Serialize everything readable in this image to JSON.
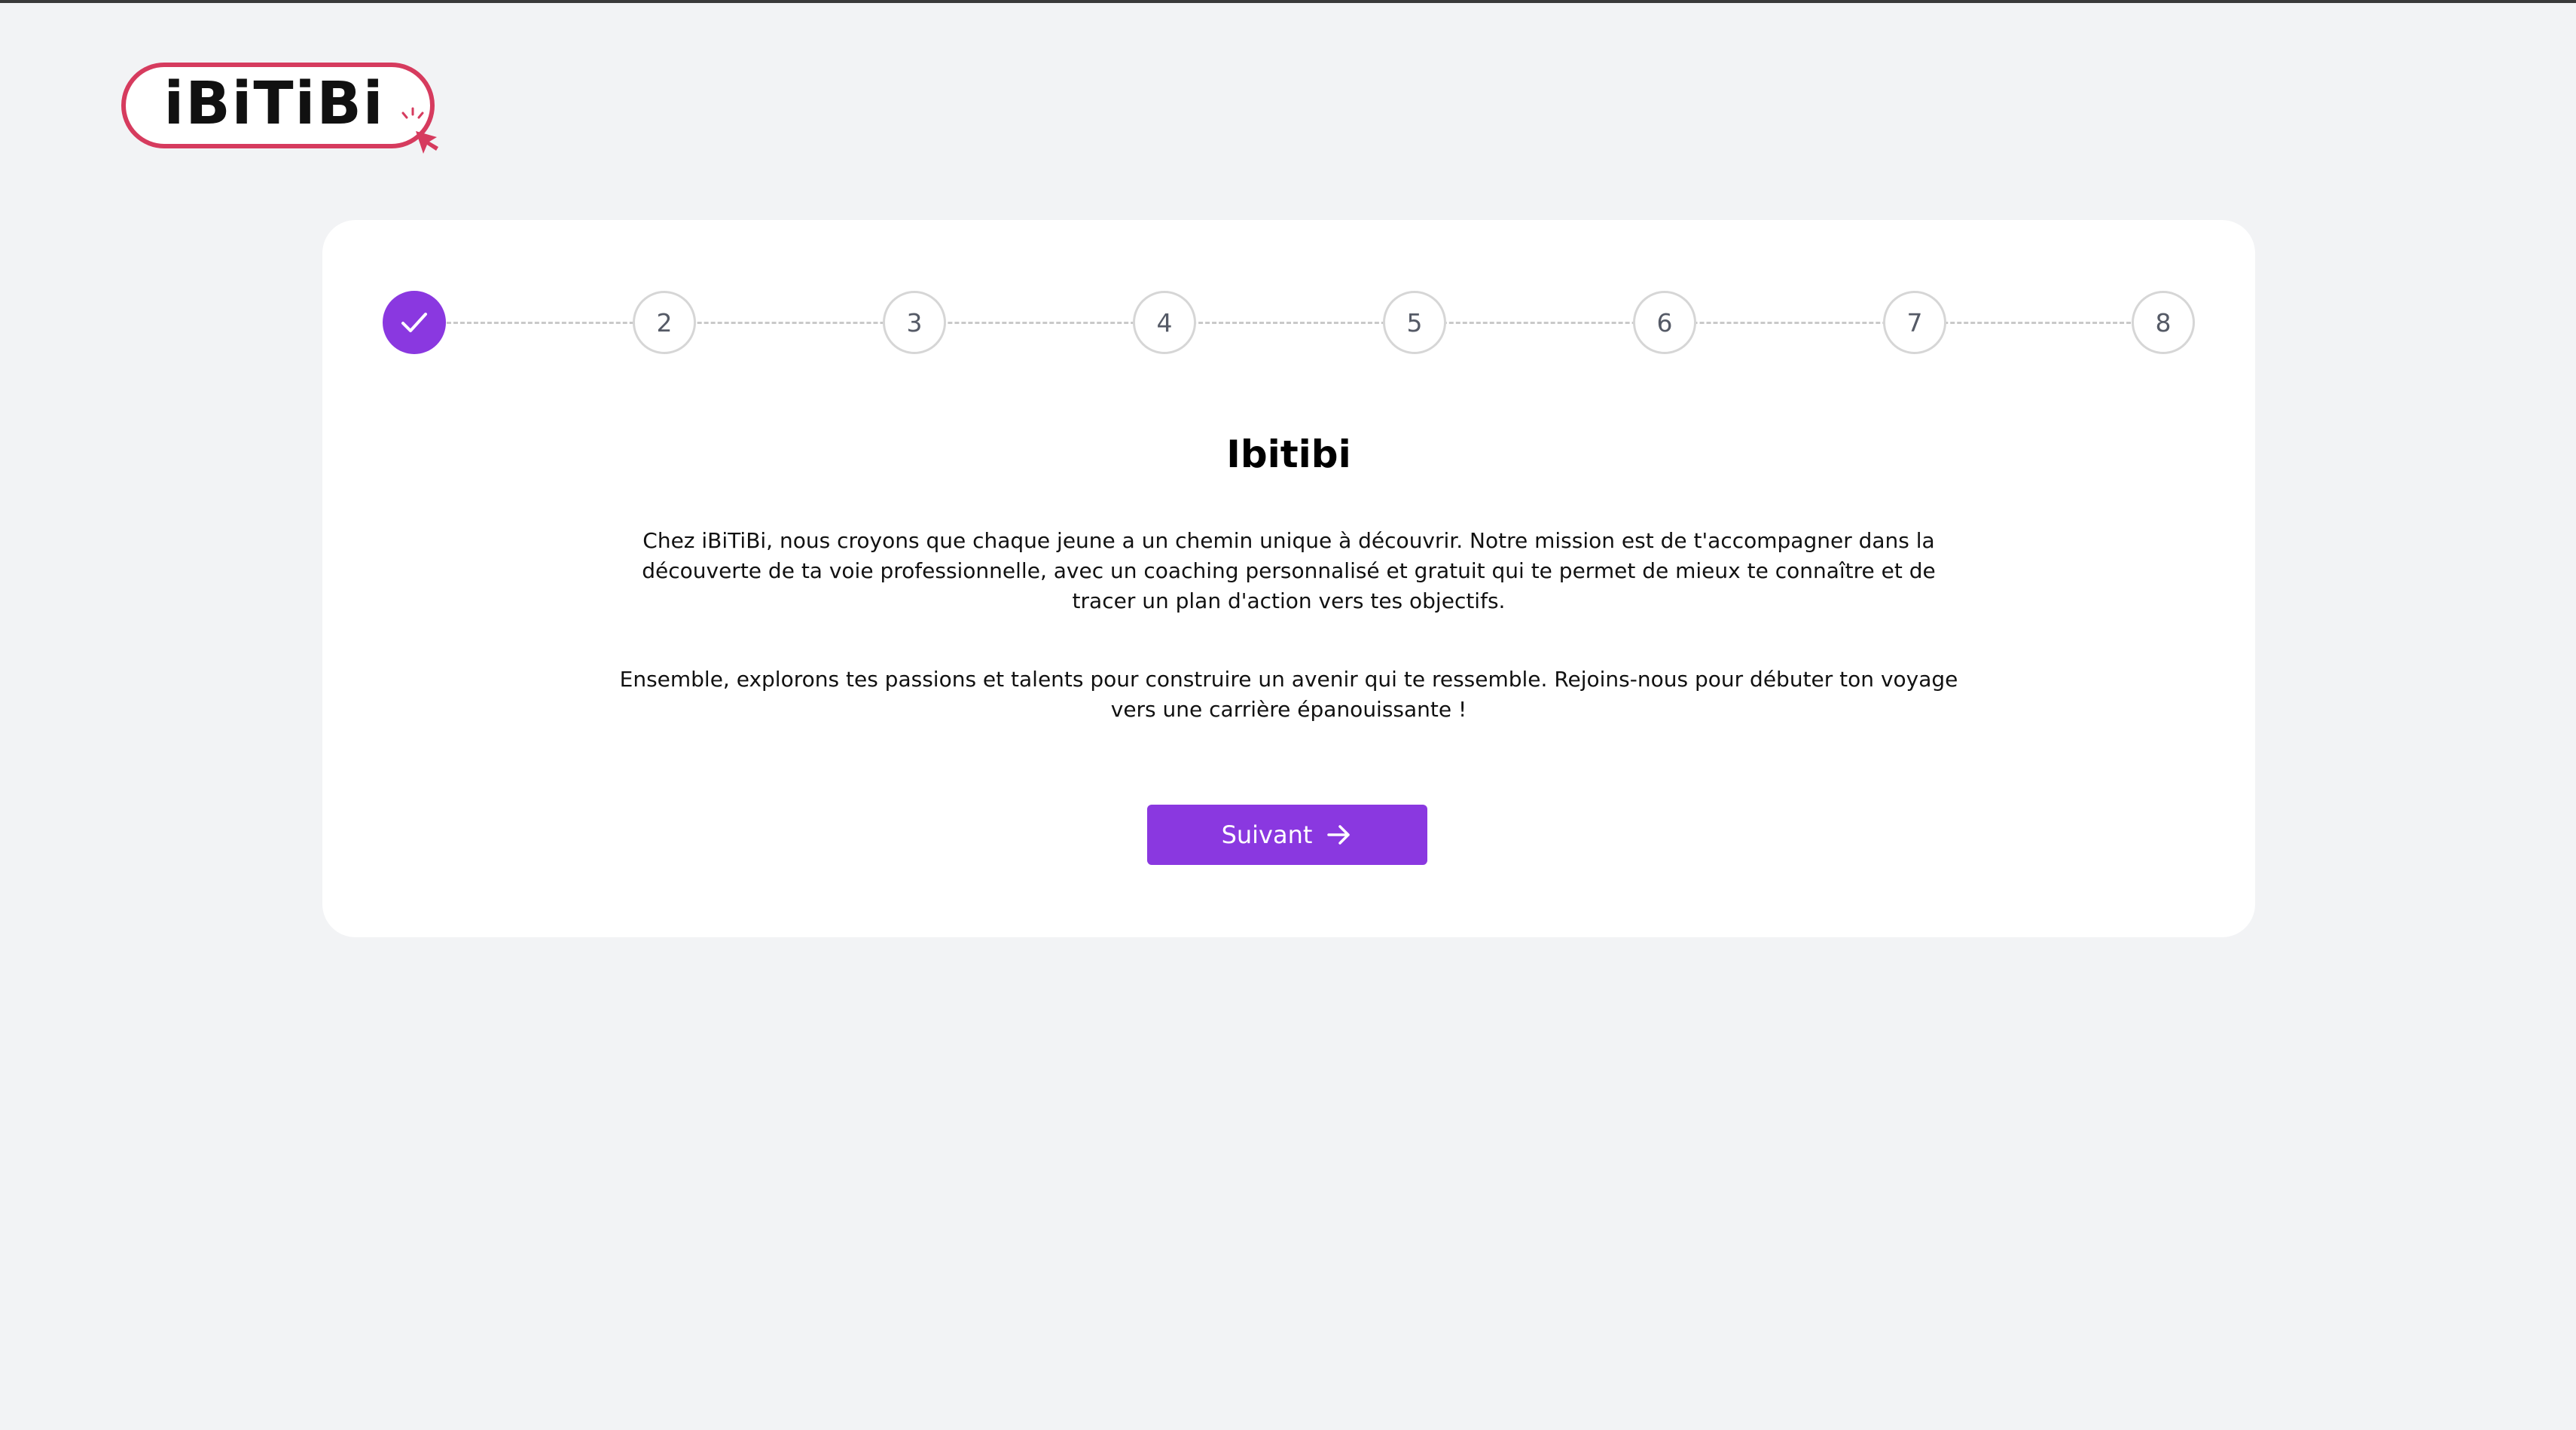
{
  "brand": {
    "logo_text": "iBiTiBi",
    "accent_color": "#d63b5e",
    "primary_color": "#8a38e0"
  },
  "stepper": {
    "current": 1,
    "steps": [
      {
        "label": "",
        "state": "done",
        "icon": "check-icon"
      },
      {
        "label": "2",
        "state": "todo"
      },
      {
        "label": "3",
        "state": "todo"
      },
      {
        "label": "4",
        "state": "todo"
      },
      {
        "label": "5",
        "state": "todo"
      },
      {
        "label": "6",
        "state": "todo"
      },
      {
        "label": "7",
        "state": "todo"
      },
      {
        "label": "8",
        "state": "todo"
      }
    ]
  },
  "content": {
    "title": "Ibitibi",
    "paragraph_1": "Chez iBiTiBi, nous croyons que chaque jeune a un chemin unique à découvrir. Notre mission est de t'accompagner dans la découverte de ta voie professionnelle, avec un coaching personnalisé et gratuit qui te permet de mieux te connaître et de tracer un plan d'action vers tes objectifs.",
    "paragraph_2": "Ensemble, explorons tes passions et talents pour construire un avenir qui te ressemble. Rejoins-nous pour débuter ton voyage vers une carrière épanouissante !"
  },
  "actions": {
    "next_label": "Suivant",
    "next_icon": "arrow-right-icon"
  }
}
